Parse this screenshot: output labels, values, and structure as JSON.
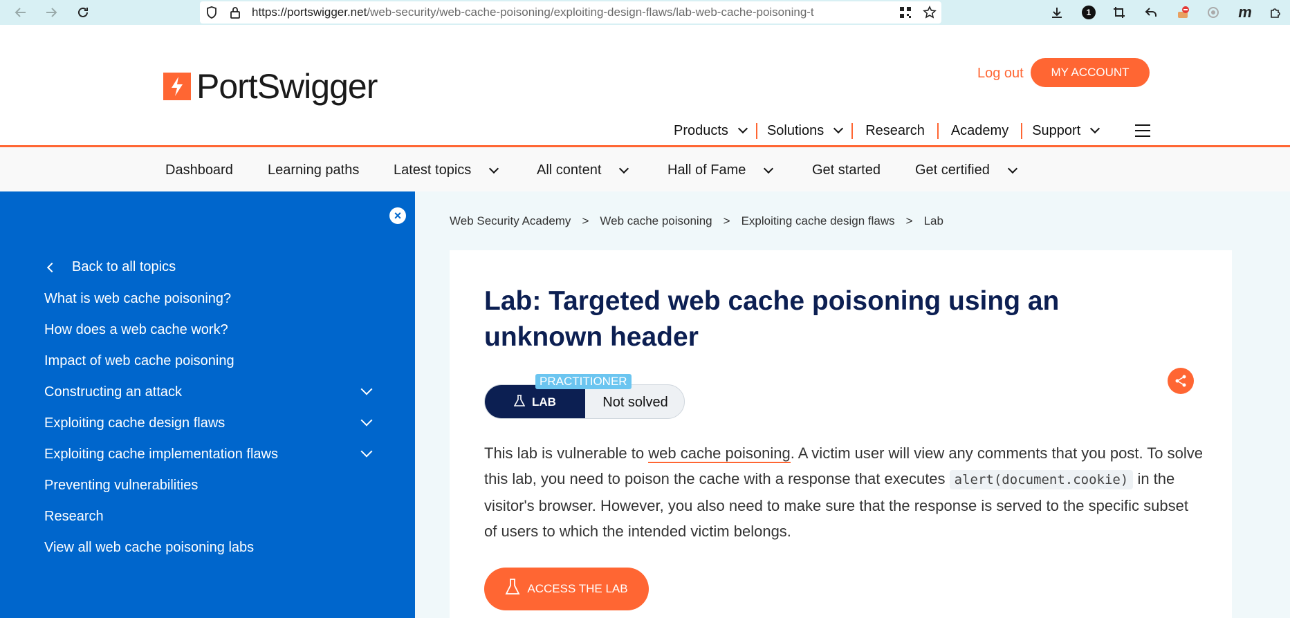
{
  "browser": {
    "url_domain": "https://portswigger.net",
    "url_path": "/web-security/web-cache-poisoning/exploiting-design-flaws/lab-web-cache-poisoning-t",
    "notification_count": "1"
  },
  "header": {
    "logo_text": "PortSwigger",
    "logout": "Log out",
    "my_account": "MY ACCOUNT",
    "nav": [
      "Products",
      "Solutions",
      "Research",
      "Academy",
      "Support"
    ]
  },
  "academy_nav": [
    "Dashboard",
    "Learning paths",
    "Latest topics",
    "All content",
    "Hall of Fame",
    "Get started",
    "Get certified"
  ],
  "sidebar": {
    "close": "×",
    "back": "Back to all topics",
    "items": [
      "What is web cache poisoning?",
      "How does a web cache work?",
      "Impact of web cache poisoning",
      "Constructing an attack",
      "Exploiting cache design flaws",
      "Exploiting cache implementation flaws",
      "Preventing vulnerabilities",
      "Research",
      "View all web cache poisoning labs"
    ]
  },
  "breadcrumb": [
    "Web Security Academy",
    "Web cache poisoning",
    "Exploiting cache design flaws",
    "Lab"
  ],
  "breadcrumb_sep": ">",
  "lab": {
    "title": "Lab: Targeted web cache poisoning using an unknown header",
    "level": "PRACTITIONER",
    "badge": "LAB",
    "status": "Not solved",
    "desc_1": "This lab is vulnerable to ",
    "desc_link": "web cache poisoning",
    "desc_2": ". A victim user will view any comments that you post. To solve this lab, you need to poison the cache with a response that executes ",
    "desc_code": "alert(document.cookie)",
    "desc_3": " in the visitor's browser. However, you also need to make sure that the response is served to the specific subset of users to which the intended victim belongs.",
    "access": "ACCESS THE LAB"
  },
  "colors": {
    "brand_orange": "#ff6633",
    "sidebar_blue": "#0066cc",
    "title_navy": "#0c1f52"
  }
}
